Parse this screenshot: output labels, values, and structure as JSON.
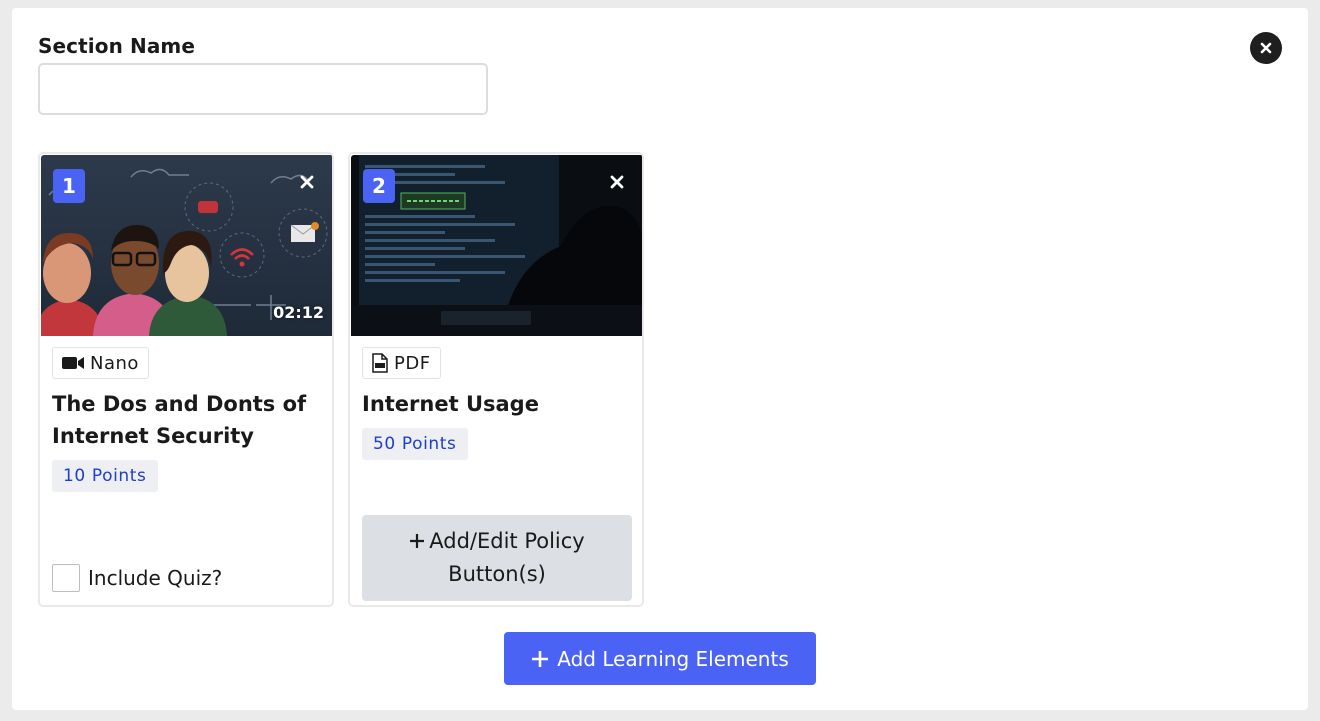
{
  "section": {
    "label": "Section Name",
    "value": "",
    "placeholder": ""
  },
  "cards": [
    {
      "order": "1",
      "duration": "02:12",
      "type_label": "Nano",
      "type_icon": "video-camera-icon",
      "title": "The Dos and Donts of Internet Security",
      "points": "10 Points",
      "quiz_label": "Include Quiz?"
    },
    {
      "order": "2",
      "type_label": "PDF",
      "type_icon": "pdf-file-icon",
      "title": "Internet Usage",
      "points": "50 Points",
      "policy_button_label": "Add/Edit Policy Button(s)"
    }
  ],
  "add_button_label": "Add Learning Elements",
  "colors": {
    "accent": "#4a63f5",
    "points_text": "#1e3fc7",
    "close_bg": "#1f1f1f"
  }
}
